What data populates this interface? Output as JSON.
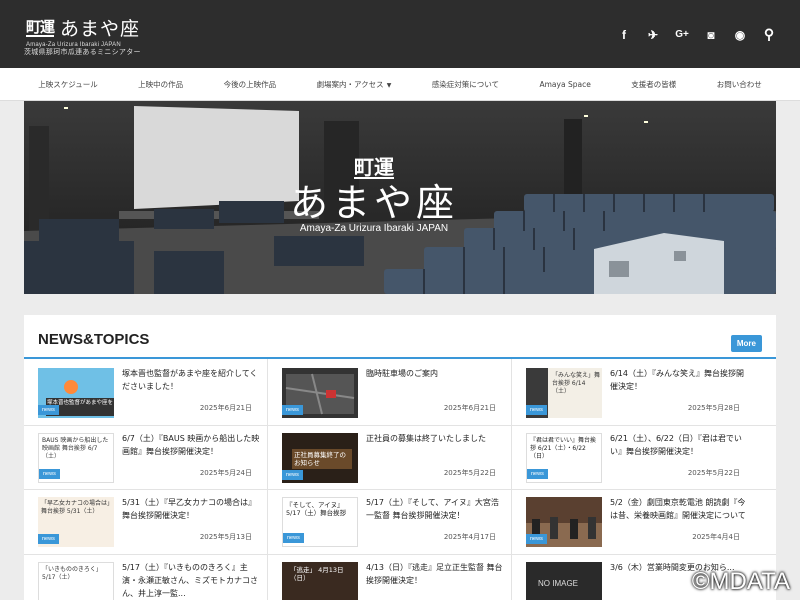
{
  "header": {
    "logo_mark": "町運",
    "logo_main": "あまや座",
    "logo_en": "Amaya-Za Urizura Ibaraki JAPAN",
    "tagline": "茨城県那珂市瓜連あるミニシアター",
    "social": [
      {
        "icon": "facebook-icon",
        "glyph": "f"
      },
      {
        "icon": "twitter-icon",
        "glyph": "✈"
      },
      {
        "icon": "google-plus-icon",
        "glyph": "G+"
      },
      {
        "icon": "instagram-icon",
        "glyph": "◙"
      },
      {
        "icon": "rss-icon",
        "glyph": "◉"
      },
      {
        "icon": "search-icon",
        "glyph": "⚲"
      }
    ]
  },
  "nav": {
    "items": [
      {
        "label": "上映スケジュール"
      },
      {
        "label": "上映中の作品"
      },
      {
        "label": "今後の上映作品"
      },
      {
        "label": "劇場案内・アクセス",
        "caret": "▼"
      },
      {
        "label": "感染症対策について"
      },
      {
        "label": "Amaya Space"
      },
      {
        "label": "支援者の皆様"
      },
      {
        "label": "お問い合わせ"
      }
    ]
  },
  "hero": {
    "mark": "町運",
    "title": "あまや座",
    "en": "Amaya-Za Urizura Ibaraki JAPAN"
  },
  "news": {
    "title": "NEWS&TOPICS",
    "more_label": "More",
    "tag_label": "news",
    "items": [
      {
        "title": "塚本晋也監督があまや座を紹介してくださいました！",
        "date": "2025年6月21日",
        "thumb_text": "塚本晋也監督があまや座を紹介"
      },
      {
        "title": "臨時駐車場のご案内",
        "date": "2025年6月21日",
        "thumb_text": ""
      },
      {
        "title": "6/14（土）『みんな笑え』舞台挨拶開催決定！",
        "date": "2025年5月28日",
        "thumb_text": "「みんな笑え」舞台挨拶 6/14（土）"
      },
      {
        "title": "6/7（土）『BAUS 映画から船出した映画館』舞台挨拶開催決定！",
        "date": "2025年5月24日",
        "thumb_text": "BAUS 映画から船出した映画館 舞台挨拶 6/7（土）"
      },
      {
        "title": "正社員の募集は終了いたしました",
        "date": "2025年5月22日",
        "thumb_text": "正社員募集終了のお知らせ"
      },
      {
        "title": "6/21（土）、6/22（日）『君は君でいい』舞台挨拶開催決定！",
        "date": "2025年5月22日",
        "thumb_text": "『君は君でいい』舞台挨拶 6/21（土）・6/22（日）"
      },
      {
        "title": "5/31（土）『早乙女カナコの場合は』舞台挨拶開催決定！",
        "date": "2025年5月13日",
        "thumb_text": "「早乙女カナコの場合は」舞台挨拶 5/31（土）"
      },
      {
        "title": "5/17（土）『そして、アイヌ』大宮浩一監督 舞台挨拶開催決定！",
        "date": "2025年4月17日",
        "thumb_text": "『そして、アイヌ』 5/17（土）舞台挨拶"
      },
      {
        "title": "5/2（金）劇団東京乾電池 朗読劇『今は昔、栄養映画館』開催決定について",
        "date": "2025年4月4日",
        "thumb_text": ""
      },
      {
        "title": "5/17（土）『いきもののきろく』主演・永瀬正敏さん、ミズモトカナコさん、井上淳一監...",
        "date": "",
        "thumb_text": "「いきもののきろく」 5/17（土）"
      },
      {
        "title": "4/13（日）『逃走』足立正生監督 舞台挨拶開催決定！",
        "date": "",
        "thumb_text": "「逃走」 4月13日（日）"
      },
      {
        "title": "3/6（木）営業時間変更のお知ら...",
        "date": "",
        "thumb_text": "NO IMAGE"
      }
    ]
  },
  "watermark": "©MDATA",
  "colors": {
    "header_bg": "#2d2d2d",
    "accent": "#3a97d8",
    "nav_bg": "#ffffff"
  }
}
